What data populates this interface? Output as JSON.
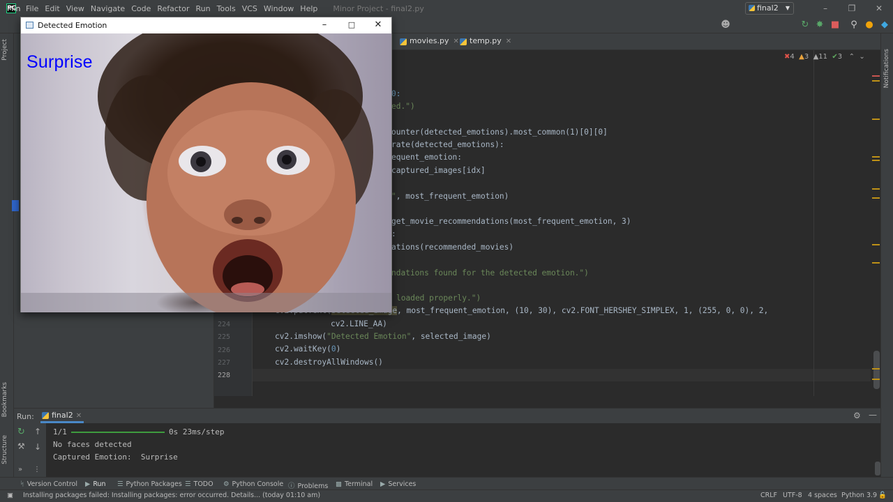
{
  "menubar": {
    "logo": "PC",
    "items": [
      "File",
      "Edit",
      "View",
      "Navigate",
      "Code",
      "Refactor",
      "Run",
      "Tools",
      "VCS",
      "Window",
      "Help"
    ],
    "window_title": "Minor Project - final2.py"
  },
  "toolbar": {
    "project_name": "Min",
    "run_config": "final2"
  },
  "left_strip": {
    "project": "Project",
    "bookmarks": "Bookmarks",
    "structure": "Structure"
  },
  "right_strip": {
    "notifications": "Notifications"
  },
  "editor": {
    "tabs": [
      {
        "label": "movies.py"
      },
      {
        "label": "temp.py"
      }
    ],
    "inspections": {
      "errors": "4",
      "warnings": "3",
      "weak_warnings": "11",
      "ok": "3"
    },
    "code_fragments": {
      "l1": "0:",
      "l2": "ed.\")",
      "l3": "ounter(detected_emotions).most_common(1)[0][0]",
      "l4": "rate(detected_emotions):",
      "l5": "equent_emotion:",
      "l6": "captured_images[idx]",
      "l7a": "\"",
      "l7b": ", most_frequent_emotion)",
      "l8": "get_movie_recommendations(most_frequent_emotion, 3)",
      "l9": ":",
      "l10": "ations(recommended_movies)",
      "l11": "ndations found for the detected emotion.\")",
      "l12": "loaded properly.\")",
      "l13a": "cv2.putText(",
      "l13b": "selected_image",
      "l13c": ", most_frequent_emotion, (10, 30), cv2.FONT_HERSHEY_SIMPLEX, 1, (255, 0, 0), 2,",
      "l224": "cv2.LINE_AA)",
      "l225a": "cv2.imshow(",
      "l225b": "\"Detected Emotion\"",
      "l225c": ", selected_image)",
      "l226a": "cv2.waitKey(",
      "l226b": "0",
      "l226c": ")",
      "l227": "cv2.destroyAllWindows()"
    },
    "line_numbers": [
      "224",
      "225",
      "226",
      "227",
      "228"
    ]
  },
  "run": {
    "label": "Run:",
    "tab": "final2",
    "console": {
      "progress": "1/1",
      "timing": "0s 23ms/step",
      "line2": "No faces detected",
      "line3": "Captured Emotion:  Surprise"
    }
  },
  "bottom_tabs": [
    "Version Control",
    "Run",
    "Python Packages",
    "TODO",
    "Python Console",
    "Problems",
    "Terminal",
    "Services"
  ],
  "statusbar": {
    "message": "Installing packages failed: Installing packages: error occurred. Details... (today 01:10 am)",
    "line_sep": "CRLF",
    "encoding": "UTF-8",
    "indent": "4 spaces",
    "interpreter": "Python 3.9"
  },
  "cv_window": {
    "title": "Detected Emotion",
    "emotion_label": "Surprise",
    "label_color": "#0000ff"
  }
}
